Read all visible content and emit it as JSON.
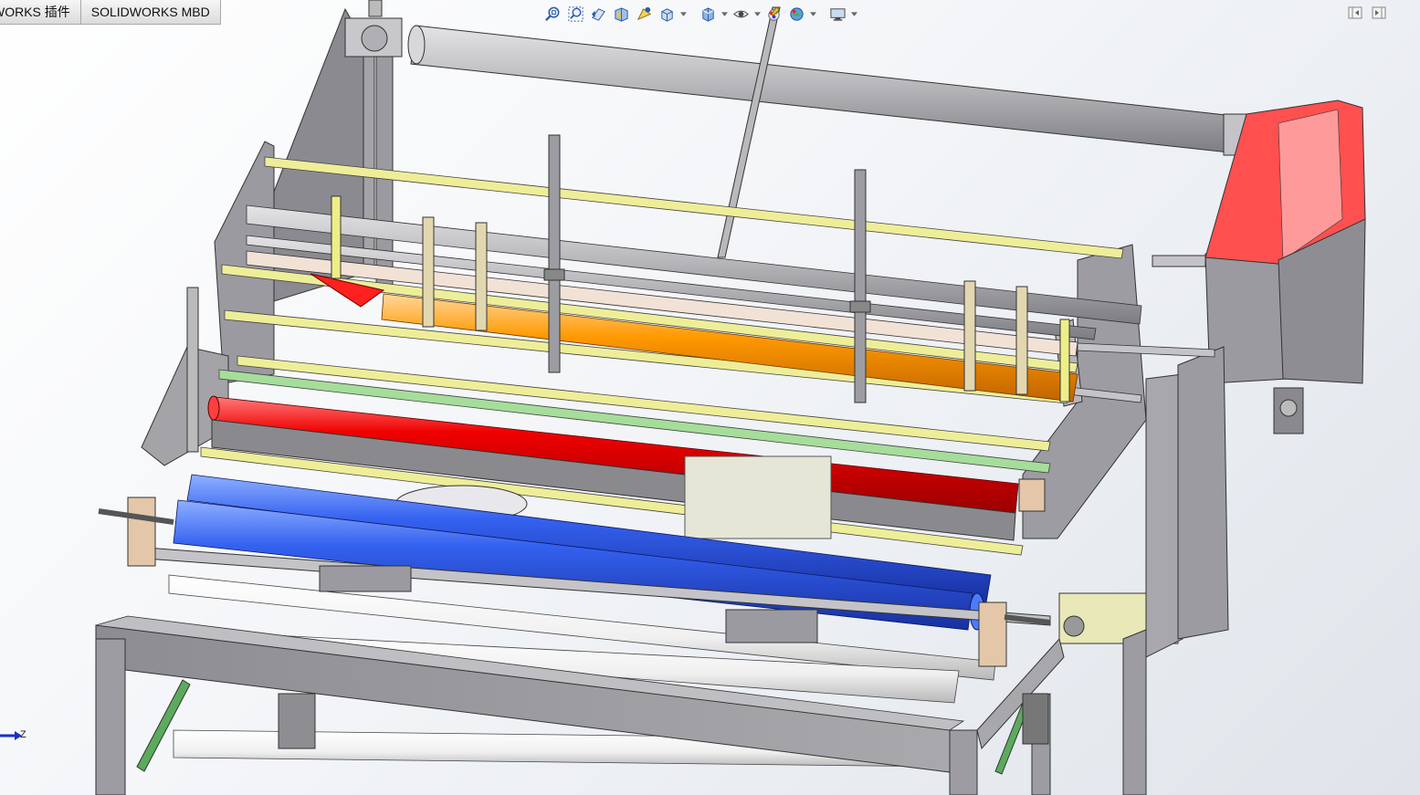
{
  "tabs": [
    {
      "label": "WORKS 插件"
    },
    {
      "label": "SOLIDWORKS MBD"
    }
  ],
  "heads_up_toolbar": [
    {
      "icon": "zoom-to-fit-icon",
      "dropdown": false
    },
    {
      "icon": "zoom-to-area-icon",
      "dropdown": false
    },
    {
      "icon": "previous-view-icon",
      "dropdown": false
    },
    {
      "icon": "section-view-icon",
      "dropdown": false
    },
    {
      "icon": "dynamic-annotation-views-icon",
      "dropdown": false
    },
    {
      "icon": "view-orientation-icon",
      "dropdown": true
    },
    {
      "icon": "display-style-icon",
      "dropdown": true
    },
    {
      "icon": "hide-show-items-icon",
      "dropdown": true
    },
    {
      "icon": "edit-appearance-icon",
      "dropdown": false
    },
    {
      "icon": "apply-scene-icon",
      "dropdown": true
    },
    {
      "icon": "view-settings-icon",
      "dropdown": true
    }
  ],
  "panel_controls": [
    {
      "icon": "expand-left-panel-icon"
    },
    {
      "icon": "expand-right-panel-icon"
    }
  ],
  "triad": {
    "axis_label": "Z"
  },
  "colors": {
    "frame": "#a8a8ac",
    "frame_dark": "#6e6e74",
    "guide_rod": "#eeee99",
    "green_rod": "#a6dd9a",
    "red_roller": "#e00000",
    "blue_roller": "#2f5fee",
    "orange_roller": "#ff9900",
    "orange_light": "#ffc878",
    "red_housing": "#ff5050",
    "tan_block": "#e3c7a8",
    "grey_shaft": "#c4c4c8",
    "white_roller": "#f6f6f6",
    "accent_green": "#5caa5c",
    "triad_blue": "#1a2ecc"
  }
}
